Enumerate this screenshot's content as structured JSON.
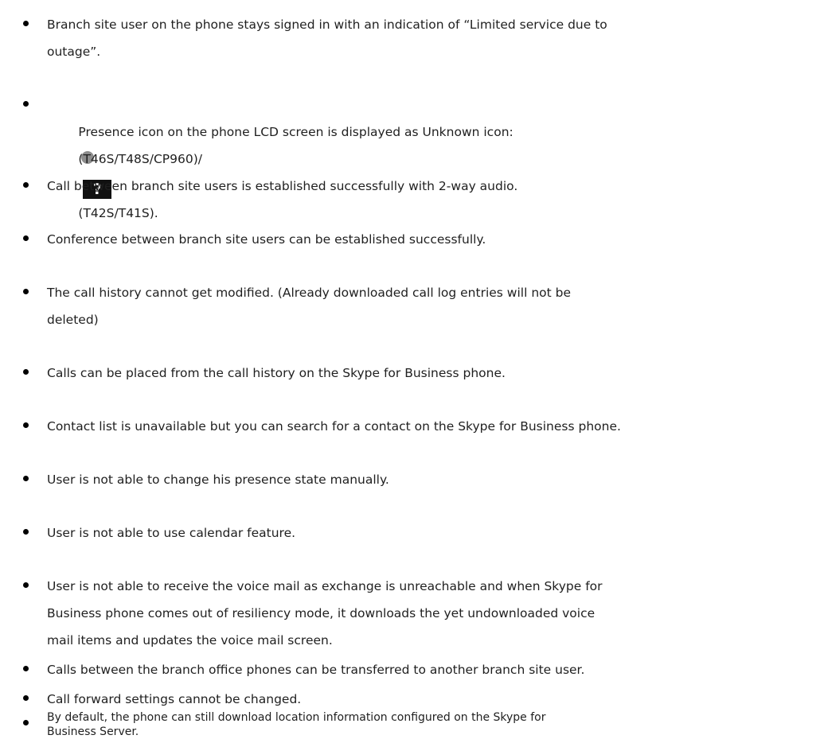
{
  "bullets": [
    {
      "lines": [
        "Branch site user on the phone stays signed in with an indication of “Limited service due to",
        "outage”."
      ]
    },
    {
      "l1": "Presence icon on the phone LCD screen is displayed as Unknown icon:",
      "l2a": "(T46S/T48S/CP960)/",
      "l2q": "?",
      "l2b": "(T42S/T41S).",
      "icon1": "unknown-presence-circle-icon",
      "icon2": "unknown-presence-question-icon"
    },
    {
      "lines": [
        "Call between branch site users is established successfully with 2-way audio."
      ]
    },
    {
      "lines": [
        "Conference between branch site users can be established successfully."
      ]
    },
    {
      "lines": [
        "The call history cannot get modified. (Already downloaded call log entries will not be",
        "deleted)"
      ]
    },
    {
      "lines": [
        "Calls can be placed from the call history on the Skype for Business phone."
      ]
    },
    {
      "lines": [
        "Contact list is unavailable but you can search for a contact on the Skype for Business phone."
      ]
    },
    {
      "lines": [
        "User is not able to change his presence state manually."
      ]
    },
    {
      "lines": [
        "User is not able to use calendar feature."
      ]
    },
    {
      "lines": [
        "User is not able to receive the voice mail as exchange is unreachable and when Skype for",
        "Business phone comes out of resiliency mode, it downloads the yet undownloaded voice",
        "mail items and updates the voice mail screen."
      ]
    },
    {
      "lines": [
        "Calls between the branch office phones can be transferred to another branch site user."
      ]
    },
    {
      "lines": [
        "Call forward settings cannot be changed."
      ]
    },
    {
      "lines": [
        "By default, the phone can still download location information configured on the Skype for",
        "Business Server."
      ]
    }
  ]
}
